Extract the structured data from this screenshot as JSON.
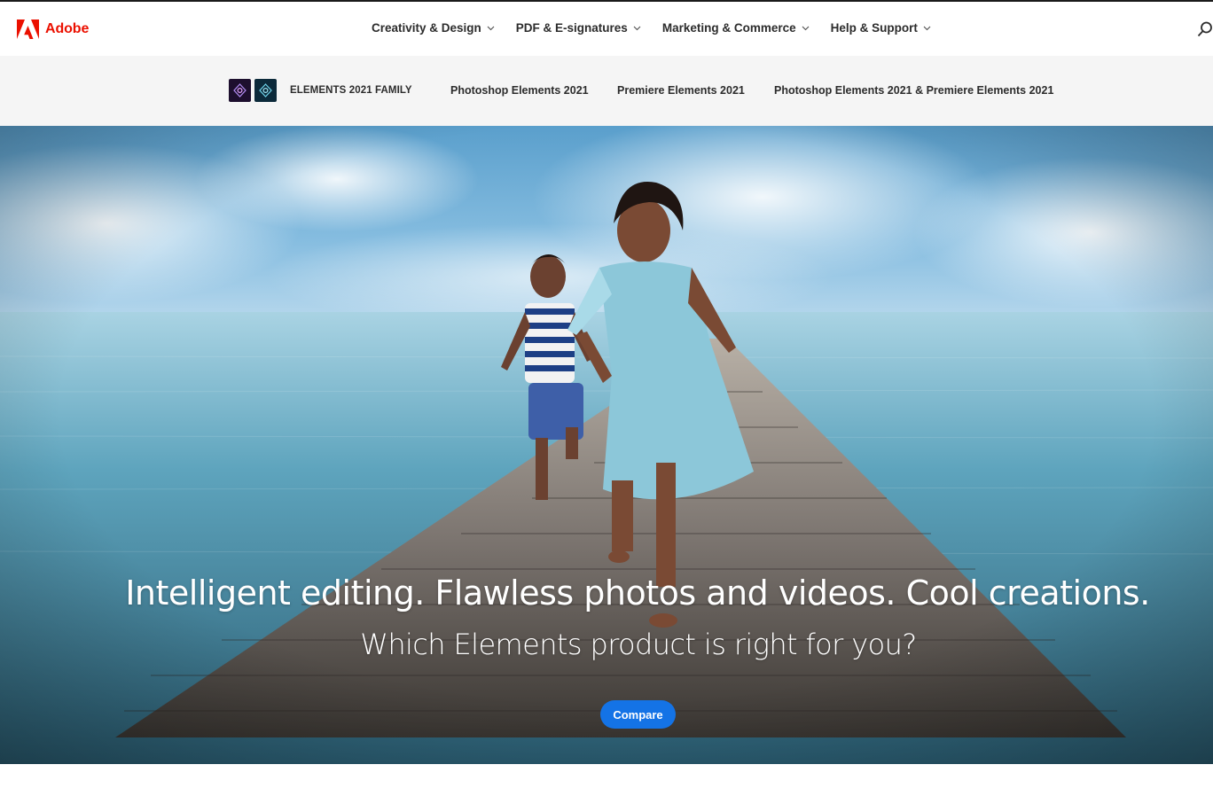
{
  "brand": {
    "name": "Adobe",
    "logo_icon": "adobe-logo-icon",
    "color": "#eb1000"
  },
  "global_nav": {
    "items": [
      {
        "label": "Creativity & Design"
      },
      {
        "label": "PDF & E-signatures"
      },
      {
        "label": "Marketing & Commerce"
      },
      {
        "label": "Help & Support"
      }
    ],
    "search_icon": "search-icon"
  },
  "sub_nav": {
    "family_icons": [
      "photoshop-elements-icon",
      "premiere-elements-icon"
    ],
    "family_title": "ELEMENTS 2021 FAMILY",
    "links": [
      {
        "label": "Photoshop Elements 2021"
      },
      {
        "label": "Premiere Elements 2021"
      },
      {
        "label": "Photoshop Elements 2021 & Premiere Elements 2021"
      }
    ]
  },
  "hero": {
    "heading": "Intelligent editing. Flawless photos and videos. Cool creations.",
    "subheading": "Which Elements product is right for you?",
    "cta_label": "Compare",
    "cta_color": "#1473e6"
  }
}
